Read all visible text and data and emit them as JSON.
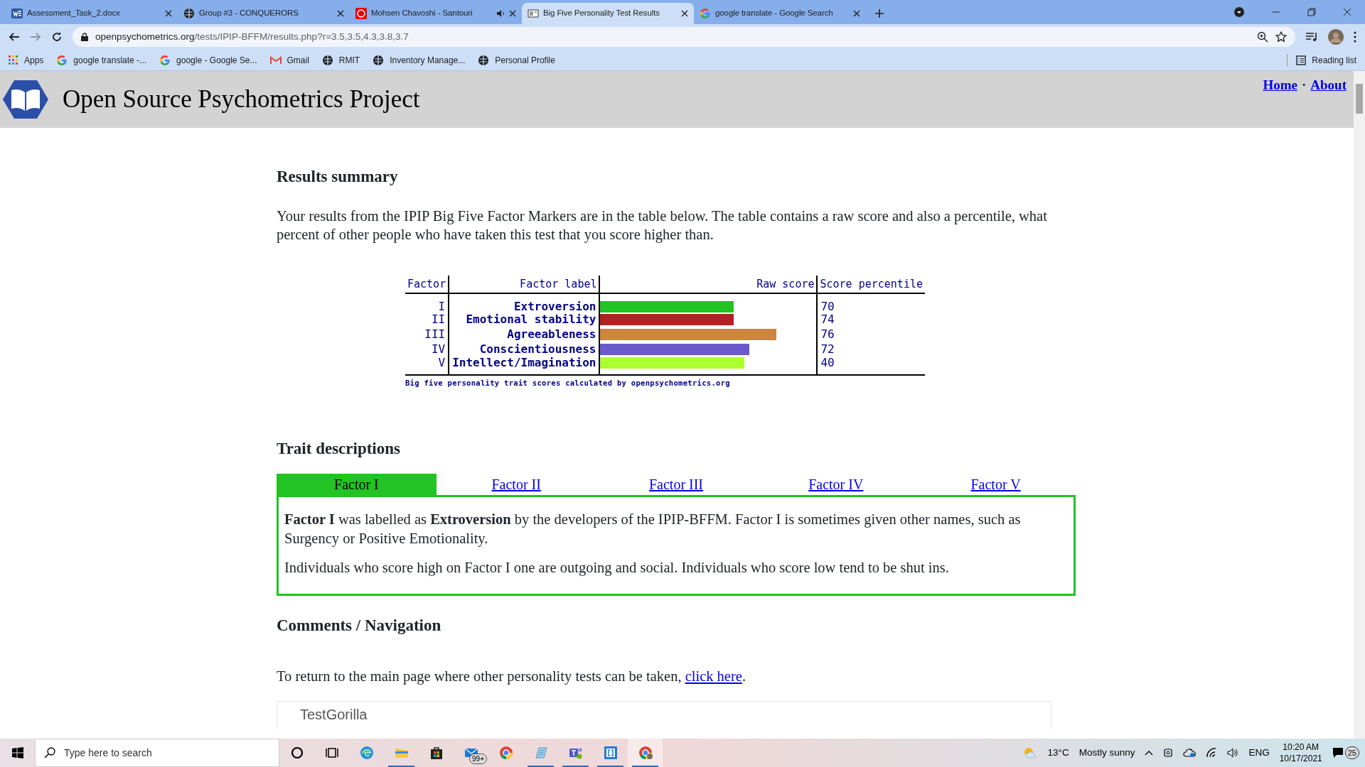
{
  "browser": {
    "tabs": [
      {
        "title": "Assessment_Task_2.docx",
        "kind": "word",
        "selected": false,
        "audio": false
      },
      {
        "title": "Group #3 - CONQUERORS",
        "kind": "globe",
        "selected": false,
        "audio": false
      },
      {
        "title": "Mohsen Chavoshi - Santouri",
        "kind": "video",
        "selected": false,
        "audio": true
      },
      {
        "title": "Big Five Personality Test Results",
        "kind": "page",
        "selected": true,
        "audio": false
      },
      {
        "title": "google translate - Google Search",
        "kind": "google",
        "selected": false,
        "audio": false
      }
    ],
    "address": {
      "host": "openpsychometrics.org",
      "path": "/tests/IPIP-BFFM/results.php?r=3.5,3.5,4.3,3.8,3.7"
    },
    "bookmarks": [
      {
        "label": "Apps",
        "kind": "apps"
      },
      {
        "label": "google translate -...",
        "kind": "google"
      },
      {
        "label": "google - Google Se...",
        "kind": "google"
      },
      {
        "label": "Gmail",
        "kind": "gmail"
      },
      {
        "label": "RMIT",
        "kind": "globe"
      },
      {
        "label": "Inventory Manage...",
        "kind": "globe"
      },
      {
        "label": "Personal Profile",
        "kind": "globe"
      }
    ],
    "reading_list": "Reading list"
  },
  "site": {
    "title": "Open Source Psychometrics Project",
    "nav": [
      {
        "label": "Home"
      },
      {
        "label": "About"
      }
    ],
    "nav_separator": "·"
  },
  "results": {
    "heading": "Results summary",
    "intro": "Your results from the IPIP Big Five Factor Markers are in the table below. The table contains a raw score and also a percentile, what percent of other people who have taken this test that you score higher than.",
    "columns": [
      "Factor",
      "Factor label",
      "Raw score",
      "Score percentile"
    ],
    "rows": [
      {
        "factor": "I",
        "label": "Extroversion",
        "level": 0.625,
        "color": "#22c322",
        "percentile": "70"
      },
      {
        "factor": "II",
        "label": "Emotional stability",
        "level": 0.625,
        "color": "#b22222",
        "percentile": "74"
      },
      {
        "factor": "III",
        "label": "Agreeableness",
        "level": 0.825,
        "color": "#cd853f",
        "percentile": "76"
      },
      {
        "factor": "IV",
        "label": "Conscientiousness",
        "level": 0.7,
        "color": "#6a5acd",
        "percentile": "72"
      },
      {
        "factor": "V",
        "label": "Intellect/Imagination",
        "level": 0.675,
        "color": "#adff2f",
        "percentile": "40"
      }
    ],
    "caption": "Big five personality trait scores calculated by openpsychometrics.org"
  },
  "traits": {
    "heading": "Trait descriptions",
    "tabs": [
      {
        "label": "Factor I",
        "selected": true
      },
      {
        "label": "Factor II",
        "selected": false
      },
      {
        "label": "Factor III",
        "selected": false
      },
      {
        "label": "Factor IV",
        "selected": false
      },
      {
        "label": "Factor V",
        "selected": false
      }
    ],
    "paragraphs": [
      "**Factor I** was labelled as **Extroversion** by the developers of the IPIP-BFFM. Factor I is sometimes given other names, such as Surgency or Positive Emotionality.",
      "Individuals who score high on Factor I one are outgoing and social. Individuals who score low tend to be shut ins."
    ]
  },
  "comments": {
    "heading": "Comments / Navigation",
    "text_before": "To return to the main page where other personality tests can be taken, ",
    "link": "click here",
    "text_after": "."
  },
  "ad": {
    "brand": "TestGorilla"
  },
  "taskbar": {
    "search_placeholder": "Type here to search",
    "apps": [
      {
        "kind": "cortana",
        "running": false,
        "selected": false
      },
      {
        "kind": "taskview",
        "running": false,
        "selected": false
      },
      {
        "kind": "edge",
        "running": false,
        "selected": false
      },
      {
        "kind": "explorer",
        "running": true,
        "selected": false
      },
      {
        "kind": "store",
        "running": false,
        "selected": false
      },
      {
        "kind": "mail",
        "running": false,
        "selected": false,
        "badge": "99+"
      },
      {
        "kind": "chrome",
        "running": false,
        "selected": false
      },
      {
        "kind": "notepad",
        "running": true,
        "selected": false
      },
      {
        "kind": "teams",
        "running": true,
        "selected": false
      },
      {
        "kind": "brackets",
        "running": true,
        "selected": false
      },
      {
        "kind": "chrome-profile",
        "running": true,
        "selected": true
      }
    ],
    "temperature": "13°C",
    "weather": "Mostly sunny",
    "language": "ENG",
    "time": "10:20 AM",
    "date": "10/17/2021",
    "notifications": "25"
  }
}
